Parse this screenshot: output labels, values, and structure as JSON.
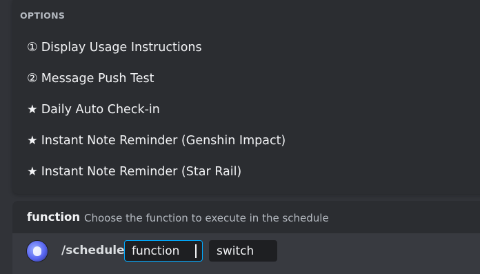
{
  "options_header": "OPTIONS",
  "options": [
    {
      "glyph": "①",
      "label": "Display Usage Instructions"
    },
    {
      "glyph": "②",
      "label": "Message Push Test"
    },
    {
      "glyph": "★",
      "label": "Daily Auto Check-in"
    },
    {
      "glyph": "★",
      "label": "Instant Note Reminder (Genshin Impact)"
    },
    {
      "glyph": "★",
      "label": "Instant Note Reminder (Star Rail)"
    }
  ],
  "hint": {
    "param_name": "function",
    "param_description": "Choose the function to execute in the schedule"
  },
  "composer": {
    "command": "/schedule",
    "params": [
      {
        "label": "function",
        "state": "active"
      },
      {
        "label": "switch",
        "state": "pending"
      }
    ]
  },
  "colors": {
    "background": "#313338",
    "popup": "#2b2d31",
    "input_bar": "#383a40",
    "param_bg": "#1e1f22",
    "focus_border": "#00a8fc"
  },
  "icons": {
    "avatar": "bot-avatar-icon"
  }
}
